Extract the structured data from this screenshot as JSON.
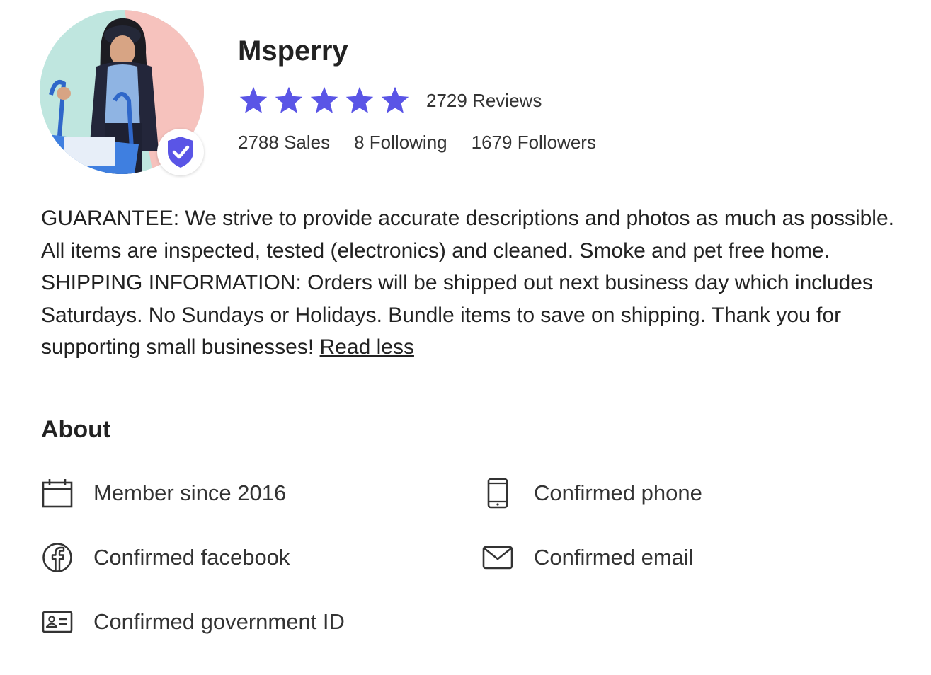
{
  "profile": {
    "username": "Msperry",
    "rating": 5,
    "rating_max": 5,
    "reviews_text": "2729 Reviews",
    "stats": {
      "sales": "2788 Sales",
      "following": "8 Following",
      "followers": "1679 Followers"
    },
    "avatar_icon": "user-avatar-photo",
    "badge_icon": "verified-shield-icon"
  },
  "bio": {
    "text": "GUARANTEE: We strive to provide accurate descriptions and photos as much as possible. All items are inspected, tested (electronics) and cleaned. Smoke and pet free home. SHIPPING INFORMATION: Orders will be shipped out next business day which includes Saturdays. No Sundays or Holidays. Bundle items to save on shipping. Thank you for supporting small businesses!",
    "read_less": "Read less"
  },
  "about": {
    "title": "About",
    "items": [
      {
        "icon": "calendar-icon",
        "label": "Member since 2016"
      },
      {
        "icon": "phone-icon",
        "label": "Confirmed phone"
      },
      {
        "icon": "facebook-icon",
        "label": "Confirmed facebook"
      },
      {
        "icon": "mail-icon",
        "label": "Confirmed email"
      },
      {
        "icon": "id-card-icon",
        "label": "Confirmed government ID"
      }
    ]
  },
  "colors": {
    "star": "#5a55e6",
    "badge": "#5a55e6",
    "text": "#222222",
    "avatar_bg_left": "#bfe6df",
    "avatar_bg_right": "#f6c2bd"
  }
}
